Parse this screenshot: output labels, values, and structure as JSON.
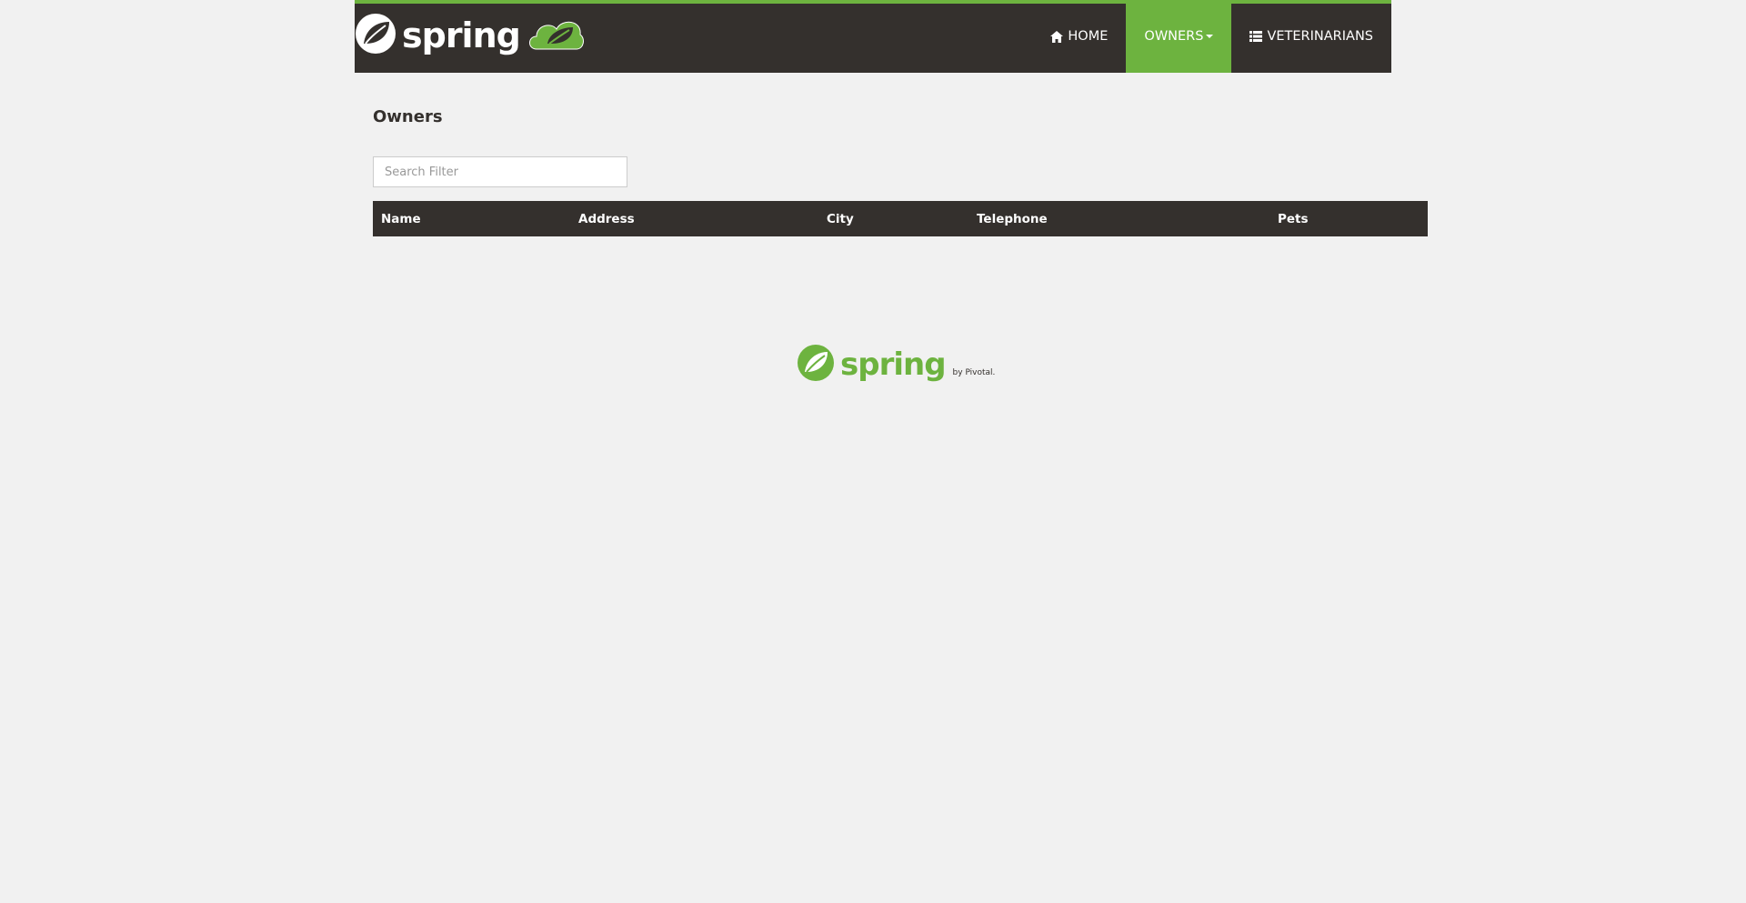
{
  "brand": {
    "name": "spring"
  },
  "nav": {
    "home_label": "Home",
    "owners_label": "Owners",
    "veterinarians_label": "Veterinarians",
    "active_color": "#6db33f",
    "bar_color": "#34302d"
  },
  "main": {
    "title": "Owners",
    "search": {
      "placeholder": "Search Filter",
      "value": ""
    },
    "table": {
      "columns": [
        "Name",
        "Address",
        "City",
        "Telephone",
        "Pets"
      ],
      "rows": []
    }
  },
  "footer": {
    "logo_text": "spring",
    "by_text": "by Pivotal."
  },
  "icons": {
    "home": "home-icon",
    "list": "list-icon",
    "caret": "caret-down-icon"
  }
}
